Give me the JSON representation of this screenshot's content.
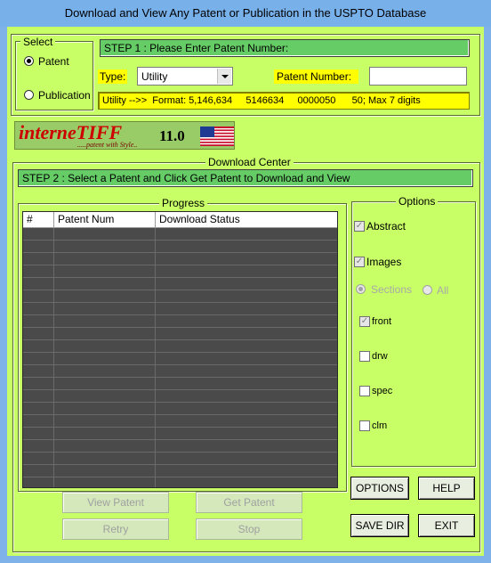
{
  "window": {
    "title": "Download and View Any Patent or Publication in the USPTO Database"
  },
  "select_group": {
    "title": "Select",
    "options": [
      {
        "label": "Patent",
        "checked": true
      },
      {
        "label": "Publication",
        "checked": false
      }
    ]
  },
  "step1": {
    "text": "STEP 1 : Please Enter Patent Number:",
    "type_label": "Type:",
    "type_value": "Utility",
    "patent_number_label": "Patent Number:",
    "patent_number_value": "",
    "format_hint": "Utility -->>  Format: 5,146,634     5146634     0000050      50; Max 7 digits"
  },
  "banner": {
    "logo_text": "interneTIFF",
    "tagline": ".....patent with Style..",
    "version": "11.0",
    "flag": "us-flag-icon"
  },
  "download_center": {
    "title": "Download Center",
    "step2": "STEP 2 : Select a Patent and Click Get Patent to Download and View",
    "progress_title": "Progress",
    "columns": [
      "#",
      "Patent Num",
      "Download Status"
    ],
    "row_count": 22,
    "buttons": {
      "view_patent": "View Patent",
      "get_patent": "Get Patent",
      "retry": "Retry",
      "stop": "Stop"
    }
  },
  "options": {
    "title": "Options",
    "abstract": {
      "label": "Abstract",
      "checked": true
    },
    "images": {
      "label": "Images",
      "checked": true
    },
    "sections": {
      "label": "Sections",
      "checked": true
    },
    "all": {
      "label": "All",
      "checked": false
    },
    "front": {
      "label": "front",
      "checked": true
    },
    "drw": {
      "label": "drw",
      "checked": false
    },
    "spec": {
      "label": "spec",
      "checked": false
    },
    "clm": {
      "label": "clm",
      "checked": false
    }
  },
  "buttons": {
    "options": "OPTIONS",
    "help": "HELP",
    "save_dir": "SAVE DIR",
    "exit": "EXIT"
  },
  "colors": {
    "background": "#c8ff66",
    "step_bar": "#66cc66",
    "highlight": "#ffff00",
    "grid": "#4a4a4a",
    "logo_red": "#cc0000"
  }
}
